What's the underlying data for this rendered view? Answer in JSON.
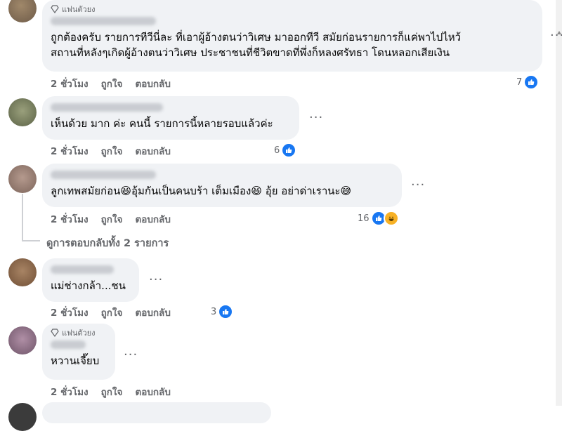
{
  "comments": [
    {
      "badge": "แฟนตัวยง",
      "text_lines": [
        "ถูกต้องครับ รายการทีวีนี่ละ ที่เอาผู้อ้างตนว่าวิเศษ มาออกทีวี สมัยก่อนรายการก็แค่พาไปไหว้",
        "สถานที่หลังๆเกิดผู้อ้างตนว่าวิเศษ ประชาชนที่ชีวิตขาดที่พึ่งก็หลงศรัทธา โดนหลอกเสียเงิน"
      ],
      "time": "2 ชั่วโมง",
      "like": "ถูกใจ",
      "reply": "ตอบกลับ",
      "reaction_count": "7"
    },
    {
      "text_lines": [
        "เห็นด้วย มาก ค่ะ คนนี้ รายการนี้หลายรอบแล้วค่ะ"
      ],
      "time": "2 ชั่วโมง",
      "like": "ถูกใจ",
      "reply": "ตอบกลับ",
      "reaction_count": "6"
    },
    {
      "text_lines": [
        "ลูกเทพสมัยก่อน😆อุ้มกันเป็นคนบร้า เต็มเมือง😆 อุ้ย อย่าด่าเรานะ😅"
      ],
      "time": "2 ชั่วโมง",
      "like": "ถูกใจ",
      "reply": "ตอบกลับ",
      "reaction_count": "16"
    },
    {
      "text_lines": [
        "แม่ช่างกล้า...ชน"
      ],
      "time": "2 ชั่วโมง",
      "like": "ถูกใจ",
      "reply": "ตอบกลับ",
      "reaction_count": "3"
    },
    {
      "badge": "แฟนตัวยง",
      "text_lines": [
        "หวานเจี๊ยบ"
      ],
      "time": "2 ชั่วโมง",
      "like": "ถูกใจ",
      "reply": "ตอบกลับ"
    }
  ],
  "view_replies": "ดูการตอบกลับทั้ง 2 รายการ",
  "more_options": "···",
  "icons": {
    "badge": "diamond-icon",
    "like": "like-thumb-icon",
    "haha": "haha-emoji-icon"
  },
  "colors": {
    "like_blue": "#1877f2",
    "bubble_bg": "#f0f2f5",
    "meta_gray": "#65676b"
  }
}
